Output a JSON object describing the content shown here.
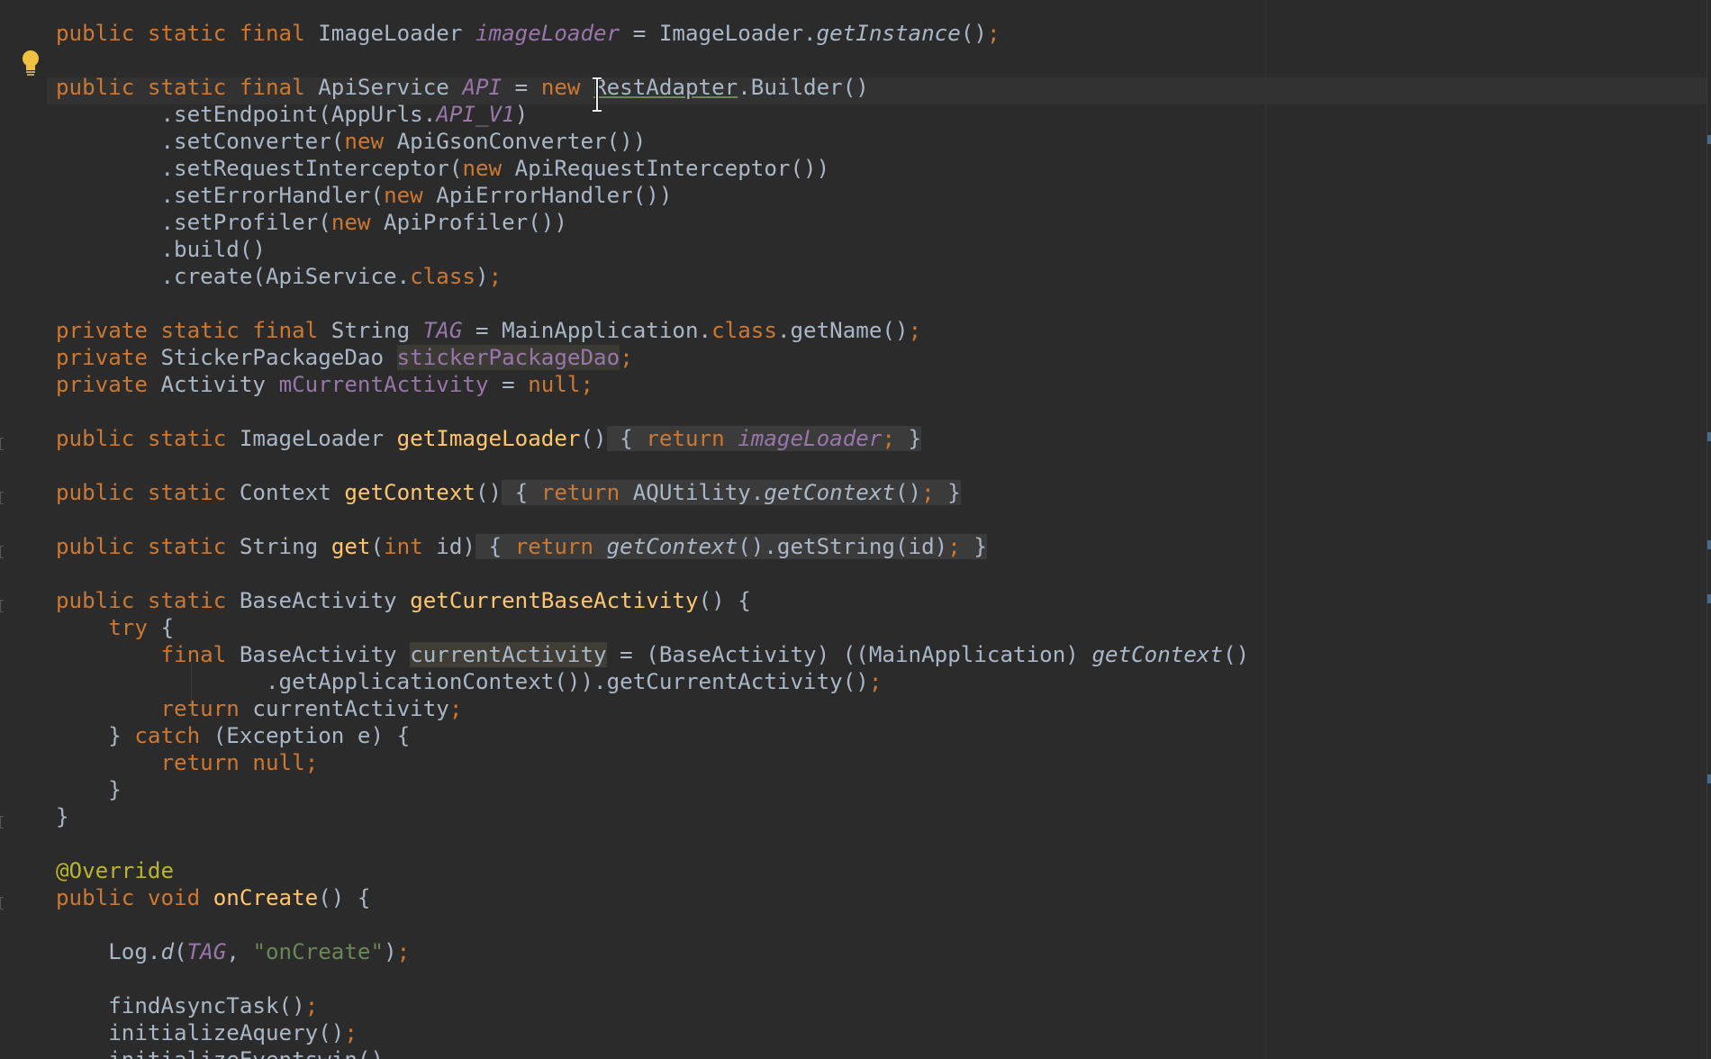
{
  "editor": {
    "language": "java",
    "theme": "darcula",
    "accent_colors": {
      "keyword": "#cc7832",
      "field": "#9876aa",
      "method": "#ffc66d",
      "annotation": "#bbb529",
      "string": "#6a8759",
      "text": "#a9b7c6",
      "background": "#2b2b2b"
    },
    "gutter_icons": [
      "intention-bulb-icon"
    ],
    "lines": [
      {
        "t1": "public static final",
        "t2": " ImageLoader ",
        "t3": "imageLoader",
        "t4": " = ImageLoader.",
        "t5": "getInstance",
        "t6": "()",
        "t7": ";"
      },
      {
        "text": ""
      },
      {
        "t1": "public static final",
        "t2": " ApiService ",
        "t3": "API",
        "t4": " = ",
        "t5": "new",
        "t6": " ",
        "t7": "RestAdapter",
        "t8": ".Builder()"
      },
      {
        "t1": "        .setEndpoint(AppUrls.",
        "t2": "API_V1",
        "t3": ")"
      },
      {
        "t1": "        .setConverter(",
        "t2": "new",
        "t3": " ApiGsonConverter())"
      },
      {
        "t1": "        .setRequestInterceptor(",
        "t2": "new",
        "t3": " ApiRequestInterceptor())"
      },
      {
        "t1": "        .setErrorHandler(",
        "t2": "new",
        "t3": " ApiErrorHandler())"
      },
      {
        "t1": "        .setProfiler(",
        "t2": "new",
        "t3": " ApiProfiler())"
      },
      {
        "t1": "        .build()"
      },
      {
        "t1": "        .create(ApiService.",
        "t2": "class",
        "t3": ")",
        "t4": ";"
      },
      {
        "text": ""
      },
      {
        "t1": "private static final",
        "t2": " String ",
        "t3": "TAG",
        "t4": " = MainApplication.",
        "t5": "class",
        "t6": ".getName()",
        "t7": ";"
      },
      {
        "t1": "private",
        "t2": " StickerPackageDao ",
        "t3": "stickerPackageDao",
        "t4": ";"
      },
      {
        "t1": "private",
        "t2": " Activity ",
        "t3": "mCurrentActivity",
        "t4": " = ",
        "t5": "null",
        "t6": ";"
      },
      {
        "text": ""
      },
      {
        "t1": "public static",
        "t2": " ImageLoader ",
        "t3": "getImageLoader",
        "t4": "()",
        "t5": " { ",
        "t6": "return",
        "t7": " ",
        "t8": "imageLoader",
        "t9": ";",
        "t10": " }"
      },
      {
        "text": ""
      },
      {
        "t1": "public static",
        "t2": " Context ",
        "t3": "getContext",
        "t4": "()",
        "t5": " { ",
        "t6": "return",
        "t7": " AQUtility.",
        "t8": "getContext",
        "t9": "()",
        "t10": ";",
        "t11": " }"
      },
      {
        "text": ""
      },
      {
        "t1": "public static",
        "t2": " String ",
        "t3": "get",
        "t4": "(",
        "t5": "int",
        "t6": " id)",
        "t7": " { ",
        "t8": "return",
        "t9": " ",
        "t10": "getContext",
        "t11": "().getString(id)",
        "t12": ";",
        "t13": " }"
      },
      {
        "text": ""
      },
      {
        "t1": "public static",
        "t2": " BaseActivity ",
        "t3": "getCurrentBaseActivity",
        "t4": "() {"
      },
      {
        "t1": "    ",
        "t2": "try",
        "t3": " {"
      },
      {
        "t1": "        ",
        "t2": "final",
        "t3": " BaseActivity ",
        "t4": "currentActivity",
        "t5": " = (BaseActivity) ((MainApplication) ",
        "t6": "getContext",
        "t7": "()"
      },
      {
        "t1": "                .getApplicationContext()).getCurrentActivity()",
        "t2": ";"
      },
      {
        "t1": "        ",
        "t2": "return",
        "t3": " currentActivity",
        "t4": ";"
      },
      {
        "t1": "    } ",
        "t2": "catch",
        "t3": " (Exception e) {"
      },
      {
        "t1": "        ",
        "t2": "return null",
        "t3": ";"
      },
      {
        "t1": "    }"
      },
      {
        "t1": "}"
      },
      {
        "text": ""
      },
      {
        "t1": "@Override"
      },
      {
        "t1": "public void",
        "t2": " ",
        "t3": "onCreate",
        "t4": "() {"
      },
      {
        "text": ""
      },
      {
        "t1": "    Log.",
        "t2": "d",
        "t3": "(",
        "t4": "TAG",
        "t5": ", ",
        "t6": "\"onCreate\"",
        "t7": ")",
        "t8": ";"
      },
      {
        "text": ""
      },
      {
        "t1": "    findAsyncTask()",
        "t2": ";"
      },
      {
        "t1": "    initializeAquery()",
        "t2": ";"
      },
      {
        "t1": "    initializeEventswin()"
      }
    ]
  }
}
